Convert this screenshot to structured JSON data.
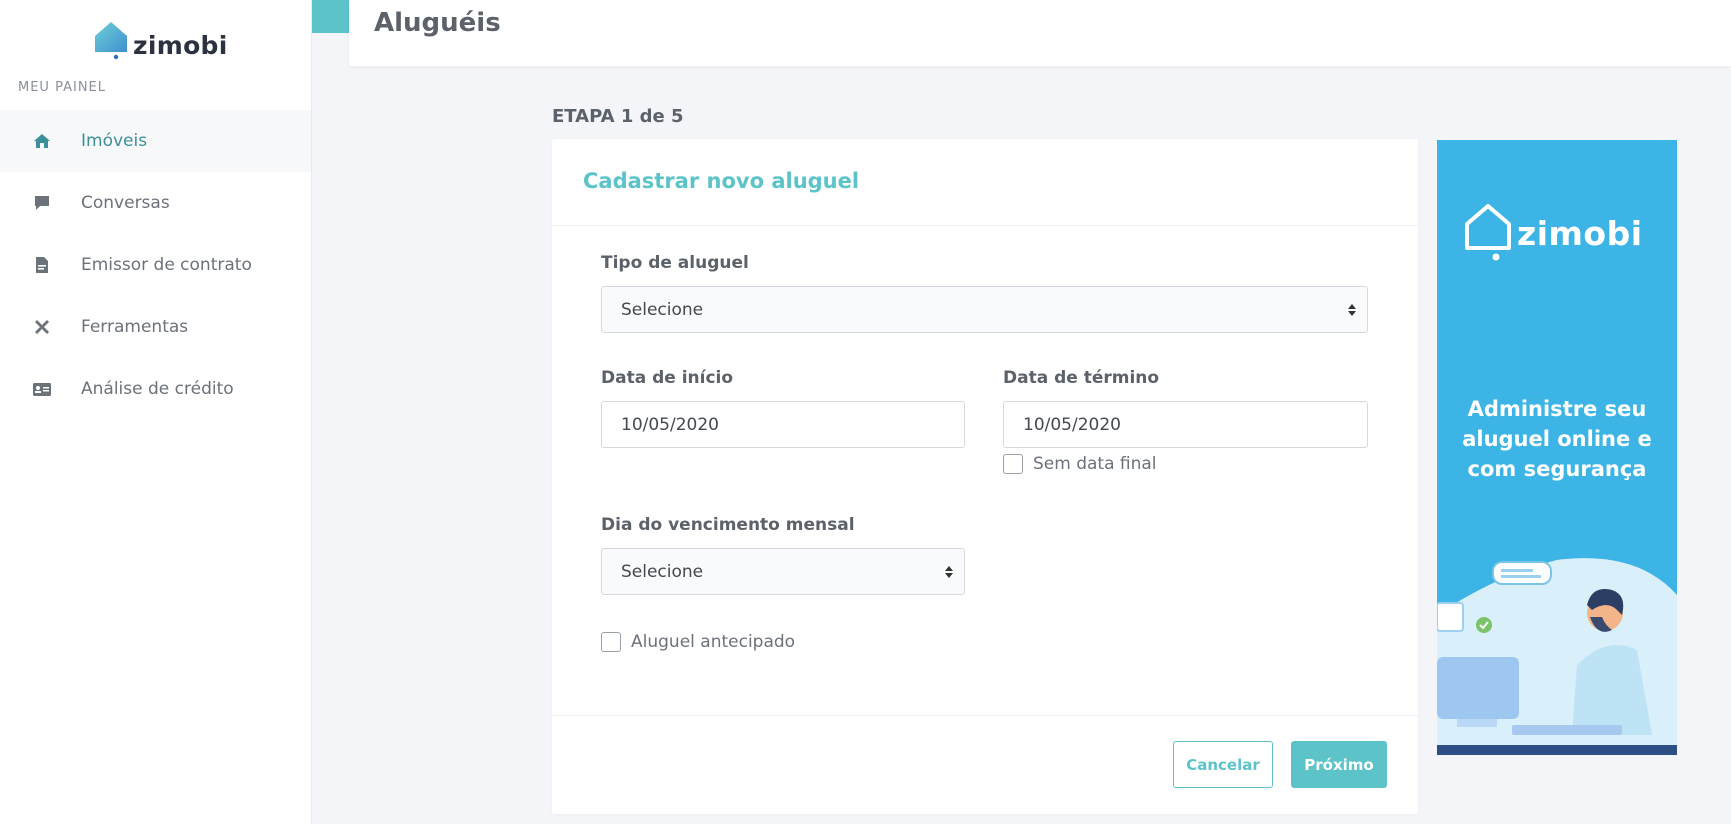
{
  "sidebar": {
    "brand": "zimobi",
    "panel_label": "MEU PAINEL",
    "items": [
      {
        "label": "Imóveis",
        "icon": "home-icon",
        "active": true
      },
      {
        "label": "Conversas",
        "icon": "chat-icon",
        "active": false
      },
      {
        "label": "Emissor de contrato",
        "icon": "document-icon",
        "active": false
      },
      {
        "label": "Ferramentas",
        "icon": "tools-icon",
        "active": false
      },
      {
        "label": "Análise de crédito",
        "icon": "id-card-icon",
        "active": false
      }
    ]
  },
  "header": {
    "title": "Aluguéis"
  },
  "step": {
    "label": "ETAPA 1 de 5"
  },
  "form": {
    "title": "Cadastrar novo aluguel",
    "rental_type": {
      "label": "Tipo de aluguel",
      "value": "Selecione"
    },
    "start_date": {
      "label": "Data de início",
      "value": "10/05/2020"
    },
    "end_date": {
      "label": "Data de término",
      "value": "10/05/2020"
    },
    "no_end_date": {
      "label": "Sem data final",
      "checked": false
    },
    "due_day": {
      "label": "Dia do vencimento mensal",
      "value": "Selecione"
    },
    "advance_rent": {
      "label": "Aluguel antecipado",
      "checked": false
    },
    "cancel_label": "Cancelar",
    "next_label": "Próximo"
  },
  "ad": {
    "brand": "zimobi",
    "headline": "Administre seu aluguel online e com segurança"
  },
  "colors": {
    "accent": "#5cc3c9",
    "ad_background": "#3db4e6",
    "active_nav_text": "#3d8f97"
  }
}
